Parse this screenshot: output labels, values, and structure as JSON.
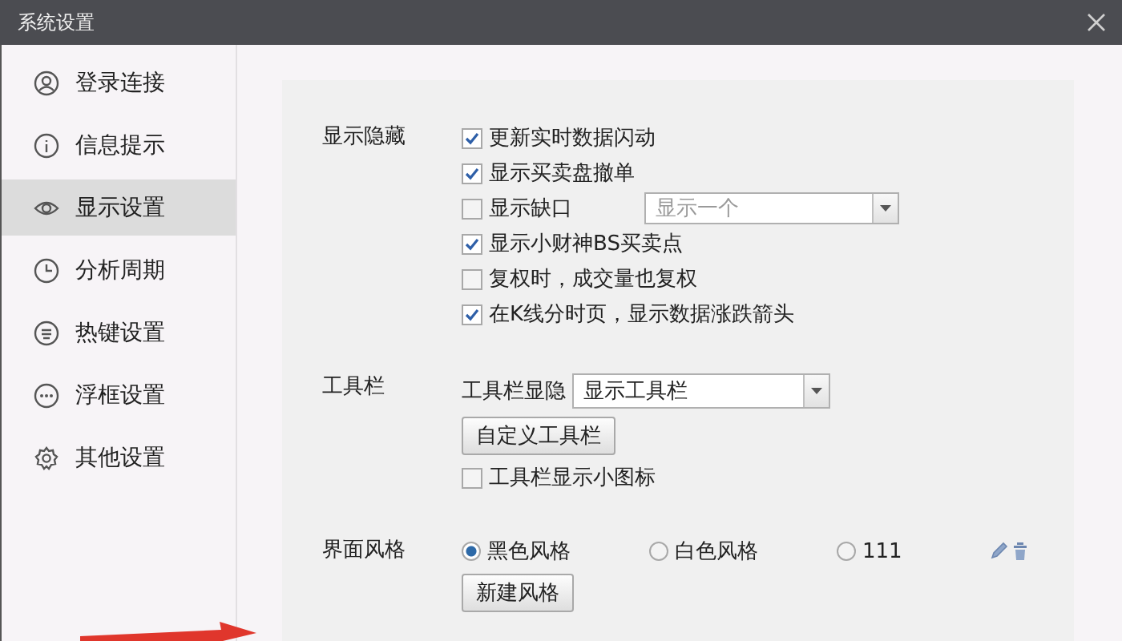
{
  "window": {
    "title": "系统设置"
  },
  "sidebar": {
    "items": [
      {
        "label": "登录连接",
        "selected": false
      },
      {
        "label": "信息提示",
        "selected": false
      },
      {
        "label": "显示设置",
        "selected": true
      },
      {
        "label": "分析周期",
        "selected": false
      },
      {
        "label": "热键设置",
        "selected": false
      },
      {
        "label": "浮框设置",
        "selected": false
      },
      {
        "label": "其他设置",
        "selected": false
      }
    ]
  },
  "sections": [
    {
      "label": "显示隐藏",
      "rows": [
        {
          "kind": "checkbox",
          "label": "更新实时数据闪动",
          "checked": true
        },
        {
          "kind": "checkbox",
          "label": "显示买卖盘撤单",
          "checked": true
        },
        {
          "kind": "checkbox",
          "label": "显示缺口",
          "checked": false,
          "dropdown": {
            "value": "显示一个",
            "disabled": true
          }
        },
        {
          "kind": "checkbox",
          "label": "显示小财神BS买卖点",
          "checked": true
        },
        {
          "kind": "checkbox",
          "label": "复权时，成交量也复权",
          "checked": false
        },
        {
          "kind": "checkbox",
          "label": "在K线分时页，显示数据涨跌箭头",
          "checked": true
        }
      ]
    },
    {
      "label": "工具栏",
      "rows": [
        {
          "kind": "select",
          "label": "工具栏显隐",
          "value": "显示工具栏"
        },
        {
          "kind": "button",
          "label": "自定义工具栏"
        },
        {
          "kind": "checkbox",
          "label": "工具栏显示小图标",
          "checked": false
        }
      ]
    },
    {
      "label": "界面风格",
      "rows": [
        {
          "kind": "radios",
          "options": [
            {
              "label": "黑色风格",
              "selected": true,
              "editable": false
            },
            {
              "label": "白色风格",
              "selected": false,
              "editable": false
            },
            {
              "label": "111",
              "selected": false,
              "editable": true
            }
          ]
        },
        {
          "kind": "button",
          "label": "新建风格"
        }
      ]
    }
  ]
}
